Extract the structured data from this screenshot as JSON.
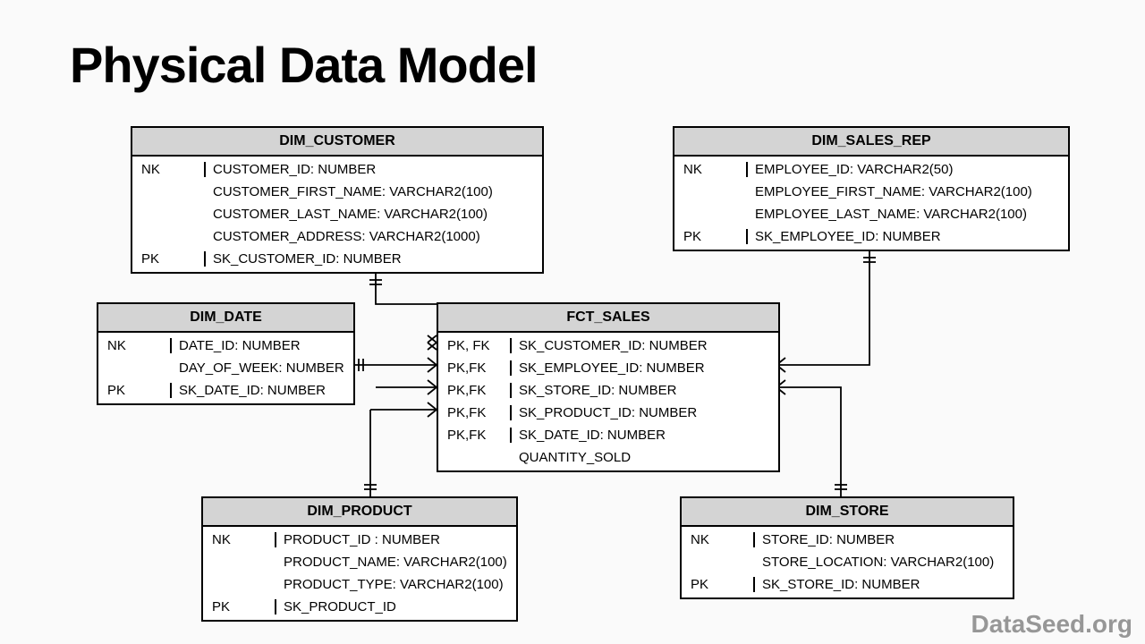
{
  "title": "Physical Data Model",
  "watermark": "DataSeed.org",
  "entities": {
    "dim_customer": {
      "name": "DIM_CUSTOMER",
      "rows": [
        {
          "key": "NK",
          "val": "CUSTOMER_ID: NUMBER"
        },
        {
          "key": "",
          "val": "CUSTOMER_FIRST_NAME: VARCHAR2(100)"
        },
        {
          "key": "",
          "val": "CUSTOMER_LAST_NAME: VARCHAR2(100)"
        },
        {
          "key": "",
          "val": "CUSTOMER_ADDRESS: VARCHAR2(1000)"
        },
        {
          "key": "PK",
          "val": "SK_CUSTOMER_ID: NUMBER"
        }
      ]
    },
    "dim_sales_rep": {
      "name": "DIM_SALES_REP",
      "rows": [
        {
          "key": "NK",
          "val": "EMPLOYEE_ID: VARCHAR2(50)"
        },
        {
          "key": "",
          "val": "EMPLOYEE_FIRST_NAME: VARCHAR2(100)"
        },
        {
          "key": "",
          "val": "EMPLOYEE_LAST_NAME: VARCHAR2(100)"
        },
        {
          "key": "PK",
          "val": "SK_EMPLOYEE_ID: NUMBER"
        }
      ]
    },
    "dim_date": {
      "name": "DIM_DATE",
      "rows": [
        {
          "key": "NK",
          "val": "DATE_ID: NUMBER"
        },
        {
          "key": "",
          "val": "DAY_OF_WEEK: NUMBER"
        },
        {
          "key": "PK",
          "val": "SK_DATE_ID: NUMBER"
        }
      ]
    },
    "fct_sales": {
      "name": "FCT_SALES",
      "rows": [
        {
          "key": "PK, FK",
          "val": "SK_CUSTOMER_ID: NUMBER"
        },
        {
          "key": "PK,FK",
          "val": "SK_EMPLOYEE_ID: NUMBER"
        },
        {
          "key": "PK,FK",
          "val": "SK_STORE_ID: NUMBER"
        },
        {
          "key": "PK,FK",
          "val": "SK_PRODUCT_ID: NUMBER"
        },
        {
          "key": "PK,FK",
          "val": "SK_DATE_ID: NUMBER"
        },
        {
          "key": "",
          "val": "QUANTITY_SOLD"
        }
      ]
    },
    "dim_product": {
      "name": "DIM_PRODUCT",
      "rows": [
        {
          "key": "NK",
          "val": "PRODUCT_ID : NUMBER"
        },
        {
          "key": "",
          "val": "PRODUCT_NAME: VARCHAR2(100)"
        },
        {
          "key": "",
          "val": "PRODUCT_TYPE: VARCHAR2(100)"
        },
        {
          "key": "PK",
          "val": "SK_PRODUCT_ID"
        }
      ]
    },
    "dim_store": {
      "name": "DIM_STORE",
      "rows": [
        {
          "key": "NK",
          "val": "STORE_ID: NUMBER"
        },
        {
          "key": "",
          "val": "STORE_LOCATION: VARCHAR2(100)"
        },
        {
          "key": "PK",
          "val": "SK_STORE_ID: NUMBER"
        }
      ]
    }
  }
}
